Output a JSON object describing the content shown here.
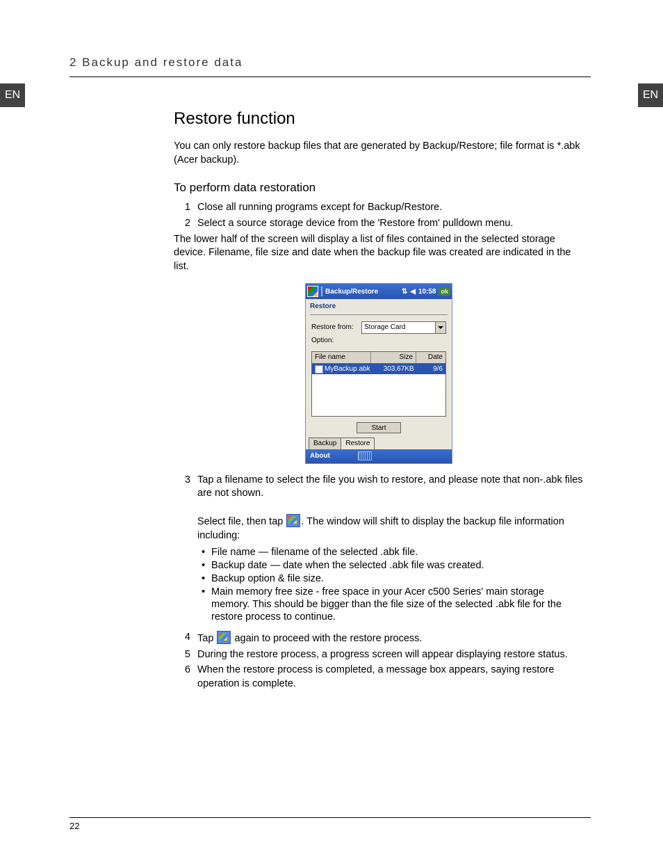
{
  "lang_tab": "EN",
  "chapter": "2 Backup and restore data",
  "page_number": "22",
  "h1": "Restore function",
  "intro": "You can only restore backup files that are generated by Backup/Restore; file format is *.abk (Acer backup).",
  "h2": "To perform data restoration",
  "step1": "Close all running programs except for Backup/Restore.",
  "step2": "Select a source storage device from the 'Restore from' pulldown menu.",
  "after2": "The lower half of the screen will display a list of files contained in the selected storage device. Filename, file size and date when the backup file was created are indicated in the list.",
  "step3a": "Tap a filename to select the file you wish to restore, and please note that non-.abk files are not shown.",
  "step3b_pre": "Select file, then tap ",
  "step3b_post": ". The window will shift to display the backup file information including:",
  "bullet1": "File name — filename of the selected .abk file.",
  "bullet2": "Backup date — date when the selected .abk file was created.",
  "bullet3": "Backup option & file size.",
  "bullet4": "Main memory free size - free space in your Acer c500 Series' main storage memory. This should be bigger than the file size of the selected .abk file for the restore process to continue.",
  "step4_pre": "Tap ",
  "step4_post": " again to proceed with the restore process.",
  "step5": "During the restore process, a progress screen will appear displaying restore status.",
  "step6": "When the restore process is completed, a message box appears, saying restore operation is complete.",
  "pda": {
    "title": "Backup/Restore",
    "time": "10:58",
    "ok": "ok",
    "tab_label": "Restore",
    "restore_from_label": "Restore from:",
    "restore_from_value": "Storage Card",
    "option_label": "Option:",
    "col_name": "File name",
    "col_size": "Size",
    "col_date": "Date",
    "row_name": "MyBackup.abk",
    "row_size": "303.67KB",
    "row_date": "9/6",
    "start": "Start",
    "tab_backup": "Backup",
    "tab_restore": "Restore",
    "about": "About"
  }
}
